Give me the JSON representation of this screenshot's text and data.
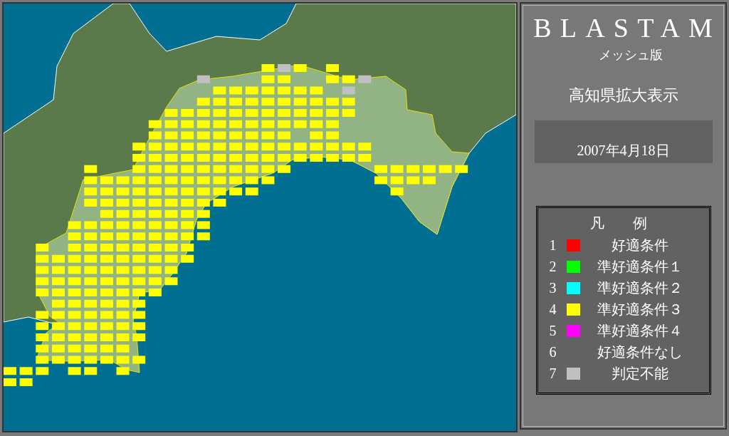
{
  "title": "BLASTAM",
  "subtitle": "メッシュ版",
  "region": "高知県拡大表示",
  "date": "2007年4月18日",
  "legend": {
    "heading": "凡　　例",
    "items": [
      {
        "number": "1",
        "label": "好適条件",
        "color": "#ff0000"
      },
      {
        "number": "2",
        "label": "準好適条件１",
        "color": "#00ff00"
      },
      {
        "number": "3",
        "label": "準好適条件２",
        "color": "#00ffff"
      },
      {
        "number": "4",
        "label": "準好適条件３",
        "color": "#ffff00"
      },
      {
        "number": "5",
        "label": "準好適条件４",
        "color": "#ff00ff"
      },
      {
        "number": "6",
        "label": "好適条件なし"
      },
      {
        "number": "7",
        "label": "判定不能",
        "color": "#c0c0c0"
      }
    ]
  }
}
